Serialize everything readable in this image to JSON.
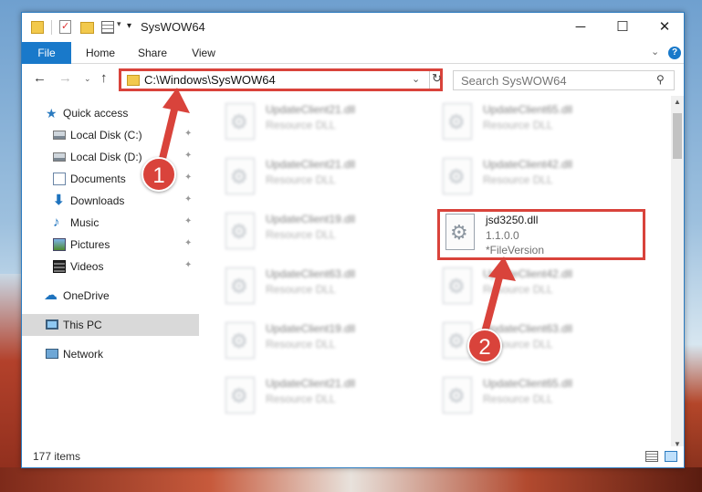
{
  "window": {
    "title": "SysWOW64",
    "minimize_glyph": "─",
    "maximize_glyph": "☐",
    "close_glyph": "✕"
  },
  "quick_access_toolbar": {
    "customize_glyph": "▾",
    "dropdown_glyph": "▾"
  },
  "ribbon": {
    "tabs": [
      "File",
      "Home",
      "Share",
      "View"
    ],
    "expand_glyph": "⌄",
    "help_glyph": "?"
  },
  "navigation": {
    "back_glyph": "←",
    "forward_glyph": "→",
    "recent_glyph": "⌄",
    "up_glyph": "↑",
    "address": "C:\\Windows\\SysWOW64",
    "address_dropdown_glyph": "⌄",
    "refresh_glyph": "↻",
    "search_placeholder": "Search SysWOW64",
    "search_glyph": "⚲"
  },
  "sidebar": {
    "pin_glyph": "✦",
    "items": [
      {
        "label": "Quick access",
        "icon": "star-icon",
        "glyph": "★"
      },
      {
        "label": "Local Disk (C:)",
        "icon": "disk-icon",
        "pinned": true
      },
      {
        "label": "Local Disk (D:)",
        "icon": "disk-icon",
        "pinned": true
      },
      {
        "label": "Documents",
        "icon": "documents-icon",
        "pinned": true
      },
      {
        "label": "Downloads",
        "icon": "download-icon",
        "glyph": "⬇",
        "pinned": true
      },
      {
        "label": "Music",
        "icon": "music-icon",
        "glyph": "♪",
        "pinned": true
      },
      {
        "label": "Pictures",
        "icon": "pictures-icon",
        "pinned": true
      },
      {
        "label": "Videos",
        "icon": "videos-icon",
        "pinned": true
      },
      {
        "label": "OneDrive",
        "icon": "cloud-icon",
        "glyph": "☁"
      },
      {
        "label": "This PC",
        "icon": "computer-icon",
        "selected": true
      },
      {
        "label": "Network",
        "icon": "network-icon"
      }
    ]
  },
  "files": {
    "gear_glyph": "⚙",
    "items": [
      {
        "name": "UpdateClient21.dll",
        "type": "Resource DLL"
      },
      {
        "name": "UpdateClient65.dll",
        "type": "Resource DLL"
      },
      {
        "name": "UpdateClient21.dll",
        "type": "Resource DLL"
      },
      {
        "name": "UpdateClient42.dll",
        "type": "Resource DLL"
      },
      {
        "name": "UpdateClient19.dll",
        "type": "Resource DLL"
      },
      {
        "name": "jsd3250.dll",
        "type": "1.1.0.0",
        "extra": "*FileVersion"
      },
      {
        "name": "UpdateClient63.dll",
        "type": "Resource DLL"
      },
      {
        "name": "UpdateClient42.dll",
        "type": "Resource DLL"
      },
      {
        "name": "UpdateClient19.dll",
        "type": "Resource DLL"
      },
      {
        "name": "UpdateClient63.dll",
        "type": "Resource DLL"
      },
      {
        "name": "UpdateClient21.dll",
        "type": "Resource DLL"
      },
      {
        "name": "UpdateClient65.dll",
        "type": "Resource DLL"
      }
    ]
  },
  "scrollbar": {
    "up_glyph": "▲",
    "down_glyph": "▼"
  },
  "status": {
    "item_count": "177 items"
  },
  "annotations": {
    "step1": "1",
    "step2": "2",
    "accent_color": "#d9433b"
  }
}
